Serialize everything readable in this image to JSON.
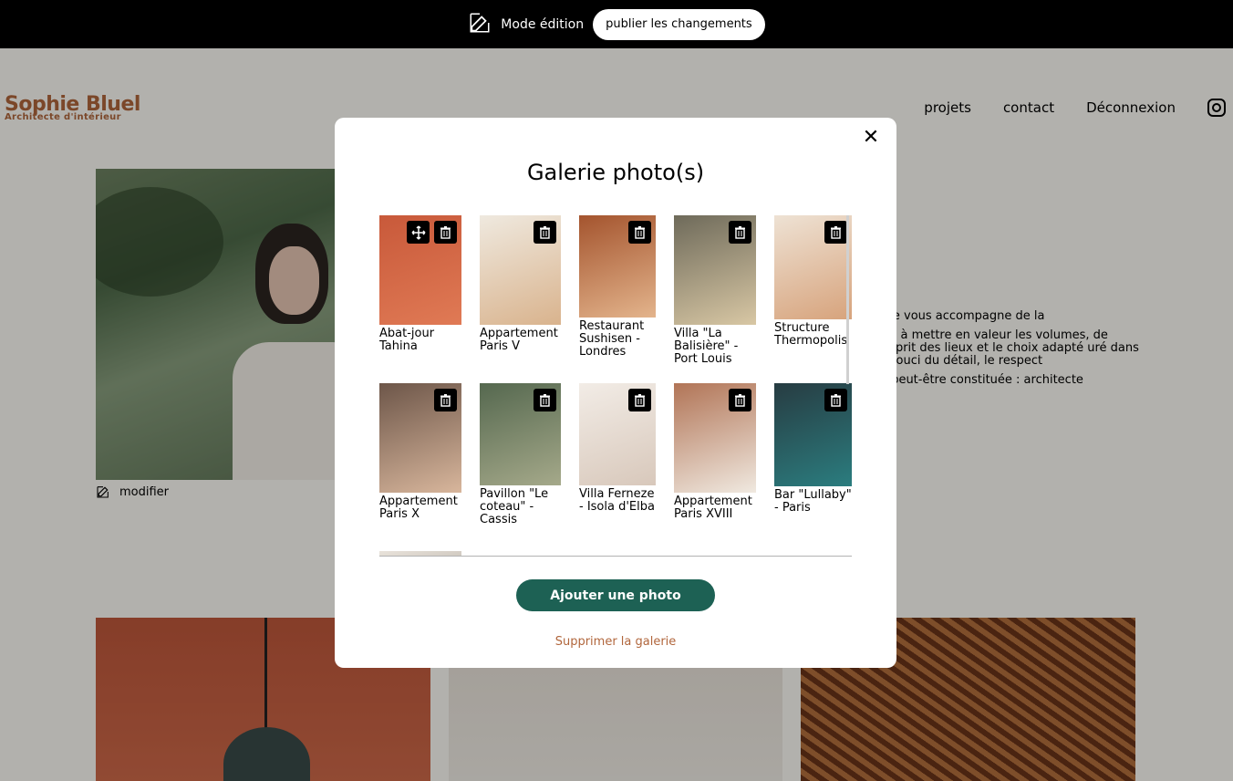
{
  "edit_bar": {
    "mode_label": "Mode édition",
    "publish_label": "publier les changements"
  },
  "header": {
    "logo_title": "Sophie Bluel",
    "logo_subtitle": "Architecte d'intérieur",
    "nav": [
      "projets",
      "contact",
      "Déconnexion"
    ]
  },
  "profile": {
    "edit_label": "modifier"
  },
  "about": {
    "paragraphs": [
      "s. Je vous accompagne de la",
      "çon à mettre en valeur les volumes, de l'esprit des lieux et le choix adapté uré dans le souci du détail, le respect",
      "re peut-être constituée : architecte"
    ]
  },
  "modal": {
    "title": "Galerie photo(s)",
    "add_button": "Ajouter une photo",
    "delete_gallery": "Supprimer la galerie",
    "items": [
      {
        "caption": "Abat-jour Tahina",
        "colors": [
          "#c8593a",
          "#e07a55"
        ],
        "move": true
      },
      {
        "caption": "Appartement Paris V",
        "colors": [
          "#efe9df",
          "#d9b38d"
        ],
        "move": false
      },
      {
        "caption": "Restaurant Sushisen - Londres",
        "colors": [
          "#a4542e",
          "#e3b48c"
        ],
        "move": false
      },
      {
        "caption": "Villa \"La Balisière\" - Port Louis",
        "colors": [
          "#6e6a5a",
          "#d8c7a4"
        ],
        "move": false
      },
      {
        "caption": "Structure Thermopolis",
        "colors": [
          "#eee2d4",
          "#d7a37c"
        ],
        "move": false
      },
      {
        "caption": "Appartement Paris X",
        "colors": [
          "#6d5649",
          "#d8b69c"
        ],
        "move": false
      },
      {
        "caption": "Pavillon \"Le coteau\" - Cassis",
        "colors": [
          "#55684f",
          "#a5a98a"
        ],
        "move": false
      },
      {
        "caption": "Villa Ferneze - Isola d'Elba",
        "colors": [
          "#f2ece6",
          "#d8c8bb"
        ],
        "move": false
      },
      {
        "caption": "Appartement Paris XVIII",
        "colors": [
          "#b17456",
          "#f0e9e0"
        ],
        "move": false
      },
      {
        "caption": "Bar \"Lullaby\" - Paris",
        "colors": [
          "#273c42",
          "#2b7d7f"
        ],
        "move": false
      },
      {
        "caption": "",
        "colors": [
          "#e8e2da",
          "#cfc8bf"
        ],
        "move": false
      }
    ]
  }
}
